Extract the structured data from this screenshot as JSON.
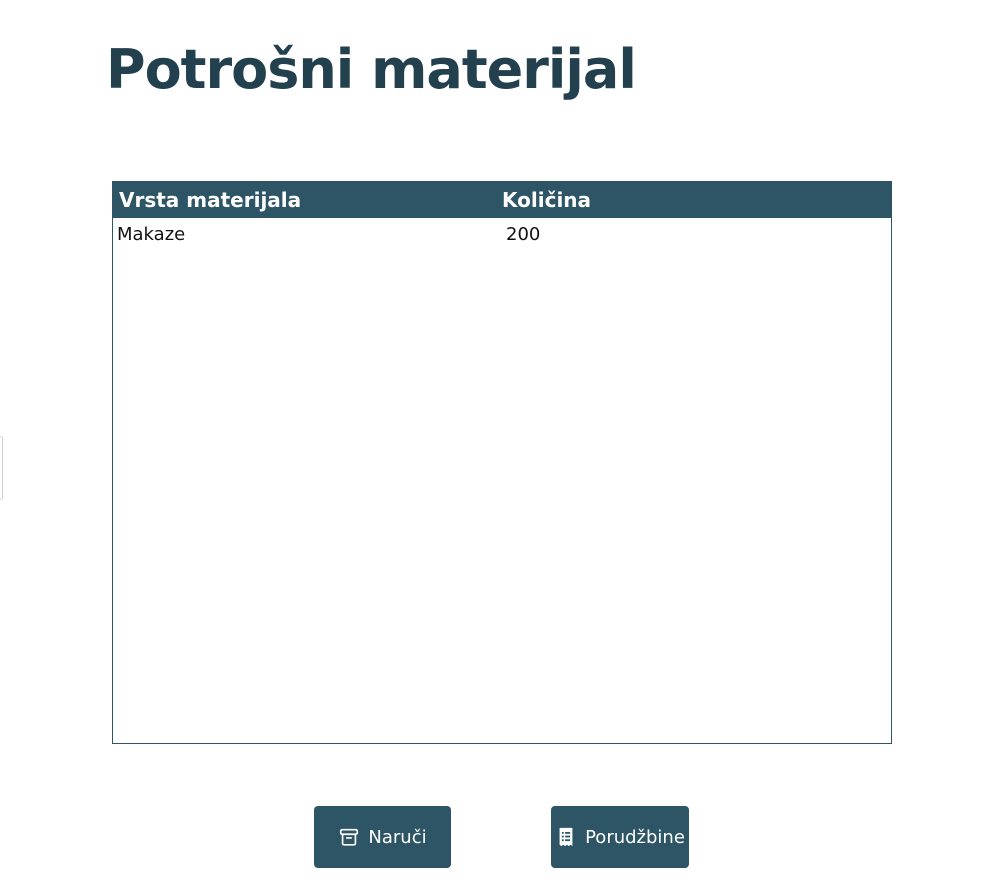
{
  "page": {
    "title": "Potrošni materijal"
  },
  "table": {
    "columns": [
      "Vrsta materijala",
      "Količina"
    ],
    "rows": [
      {
        "name": "Makaze",
        "quantity": "200"
      }
    ]
  },
  "buttons": {
    "order_label": "Naruči",
    "order_icon": "archive-box-icon",
    "orders_label": "Porudžbine",
    "orders_icon": "receipt-list-icon"
  },
  "colors": {
    "accent": "#2d5566",
    "title": "#22404d"
  }
}
